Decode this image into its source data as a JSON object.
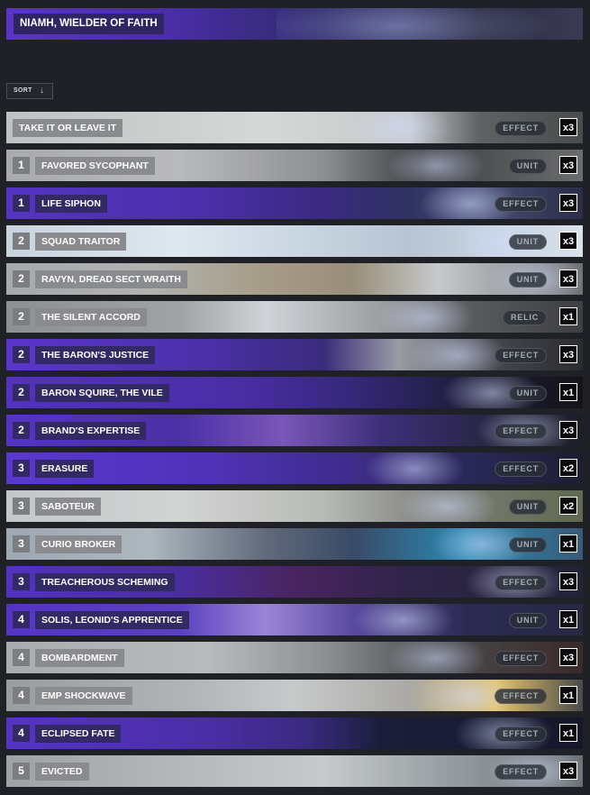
{
  "header": {
    "title": "NIAMH, WIELDER OF FAITH"
  },
  "sort": {
    "label": "SORT",
    "icon": "sort-down-arrow-icon",
    "arrow": "↓"
  },
  "cards": [
    {
      "cost": "",
      "name": "TAKE IT OR LEAVE IT",
      "type": "EFFECT",
      "qty": "x3",
      "style": "light",
      "bg": "linear-gradient(90deg,#bfc1c2 0%,#d6d8d8 45%,#c6c8c9 70%,#5f6163 82%,#4a4b4c 100%)"
    },
    {
      "cost": "1",
      "name": "FAVORED SYCOPHANT",
      "type": "UNIT",
      "qty": "x3",
      "style": "light",
      "bg": "linear-gradient(90deg,#a9aaad 0%,#b9babc 30%,#8e8f92 55%,#3d3e40 72%,#6b6c6e 100%)"
    },
    {
      "cost": "1",
      "name": "LIFE SIPHON",
      "type": "EFFECT",
      "qty": "x3",
      "style": "dark",
      "bg": "linear-gradient(90deg,#5534c4 0%,#4a2fa8 35%,#3a2a80 55%,#2f3260 70%,#4a5078 82%,#2a2d48 100%)"
    },
    {
      "cost": "2",
      "name": "SQUAD TRAITOR",
      "type": "UNIT",
      "qty": "x3",
      "style": "light",
      "bg": "linear-gradient(90deg,#c8d2dc 0%,#dfe8f0 30%,#cad6e2 50%,#b8c4d2 70%,#d8e2ec 100%)"
    },
    {
      "cost": "2",
      "name": "RAVYN, DREAD SECT WRAITH",
      "type": "UNIT",
      "qty": "x3",
      "style": "light",
      "bg": "linear-gradient(90deg,#a7a9ad 0%,#b2b2b0 25%,#a69c86 45%,#988e7a 60%,#c7c9cb 75%,#6e7073 100%)"
    },
    {
      "cost": "2",
      "name": "THE SILENT ACCORD",
      "type": "RELIC",
      "qty": "x1",
      "style": "light",
      "bg": "linear-gradient(90deg,#8d8f91 0%,#a0a2a4 30%,#d0d4d8 45%,#9c9ea0 65%,#5a5b5e 80%,#3e3f42 100%)"
    },
    {
      "cost": "2",
      "name": "THE BARON'S JUSTICE",
      "type": "EFFECT",
      "qty": "x3",
      "style": "dark",
      "bg": "linear-gradient(90deg,#5a36cc 0%,#4a30a8 35%,#3a2c7a 55%,#9a9ca4 68%,#45464c 85%,#2b2c30 100%)"
    },
    {
      "cost": "2",
      "name": "BARON SQUIRE, THE VILE",
      "type": "UNIT",
      "qty": "x1",
      "style": "dark",
      "bg": "linear-gradient(90deg,#5232c0 0%,#4a2ea6 40%,#35287a 60%,#1f1d3a 80%,#141418 100%)"
    },
    {
      "cost": "2",
      "name": "BRAND'S EXPERTISE",
      "type": "EFFECT",
      "qty": "x3",
      "style": "dark",
      "bg": "linear-gradient(90deg,#5534c4 0%,#4a30a6 30%,#7a56b8 48%,#3d2f7a 65%,#262540 85%,#1e1e2a 100%)"
    },
    {
      "cost": "3",
      "name": "ERASURE",
      "type": "EFFECT",
      "qty": "x2",
      "style": "dark",
      "bg": "linear-gradient(90deg,#5a38d0 0%,#4f32b8 35%,#3f2c8a 60%,#2a2858 80%,#1d1d32 100%)"
    },
    {
      "cost": "3",
      "name": "SABOTEUR",
      "type": "UNIT",
      "qty": "x2",
      "style": "light",
      "bg": "linear-gradient(90deg,#c4c6c8 0%,#d2d3d3 30%,#b8bab7 55%,#7d7e78 75%,#5e6a50 100%)"
    },
    {
      "cost": "3",
      "name": "CURIO BROKER",
      "type": "UNIT",
      "qty": "x1",
      "style": "light",
      "bg": "linear-gradient(90deg,#9ea8b2 0%,#aeb6be 25%,#606a7a 45%,#3a4a66 60%,#2a8ab4 80%,#3a5a78 100%)"
    },
    {
      "cost": "3",
      "name": "TREACHEROUS SCHEMING",
      "type": "EFFECT",
      "qty": "x3",
      "style": "dark",
      "bg": "linear-gradient(90deg,#5232c0 0%,#4a2ea0 30%,#4a2460 50%,#2e2448 70%,#232336 100%)"
    },
    {
      "cost": "4",
      "name": "SOLIS, LEONID'S APPRENTICE",
      "type": "UNIT",
      "qty": "x1",
      "style": "dark",
      "bg": "linear-gradient(90deg,#5534c4 0%,#5a40c0 30%,#9a86d8 45%,#5a4aa0 60%,#2c2a52 80%,#262844 100%)"
    },
    {
      "cost": "4",
      "name": "BOMBARDMENT",
      "type": "EFFECT",
      "qty": "x3",
      "style": "light",
      "bg": "linear-gradient(90deg,#a9abad 0%,#b8babc 35%,#8e9092 55%,#4a4b4d 75%,#3a2a2a 100%)"
    },
    {
      "cost": "4",
      "name": "EMP SHOCKWAVE",
      "type": "EFFECT",
      "qty": "x1",
      "style": "light",
      "bg": "linear-gradient(90deg,#9a9c9e 0%,#b0b2b4 30%,#c8c9ca 50%,#aaa9a6 70%,#e4c46a 85%,#4a4a4a 100%)"
    },
    {
      "cost": "4",
      "name": "ECLIPSED FATE",
      "type": "EFFECT",
      "qty": "x1",
      "style": "dark",
      "bg": "linear-gradient(90deg,#5534c4 0%,#4a2ea6 35%,#3a2a80 52%,#1a1e3a 65%,#15172a 100%)"
    },
    {
      "cost": "5",
      "name": "EVICTED",
      "type": "EFFECT",
      "qty": "x3",
      "style": "light",
      "bg": "linear-gradient(90deg,#9ea2a4 0%,#b4b8ba 30%,#c6cacc 55%,#9aa0a4 75%,#6a7074 100%)"
    }
  ]
}
